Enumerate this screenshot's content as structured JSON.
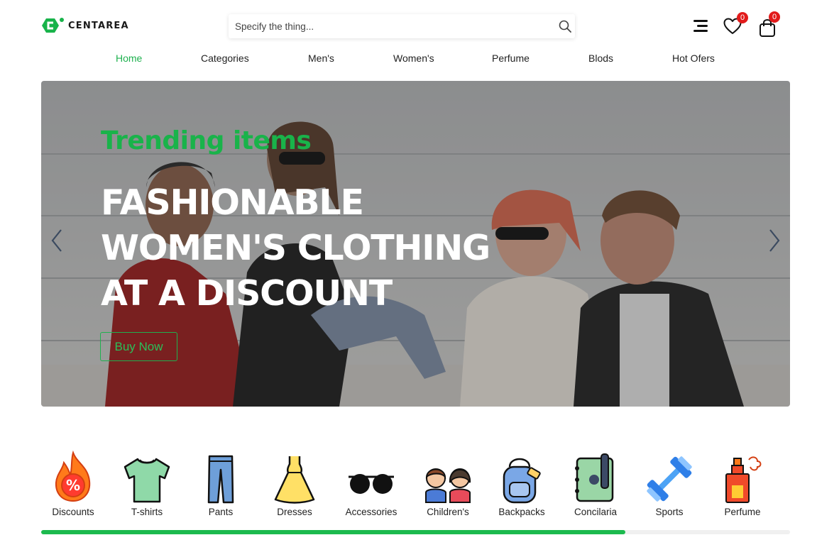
{
  "brand": {
    "name": "CENTAREA",
    "accent": "#1fb14f"
  },
  "search": {
    "placeholder": "Specify the thing..."
  },
  "header_icons": {
    "menu_icon": "menu-icon",
    "wishlist_count": "0",
    "cart_count": "0"
  },
  "nav": {
    "items": [
      {
        "label": "Home",
        "active": true
      },
      {
        "label": "Categories",
        "active": false
      },
      {
        "label": "Men's",
        "active": false
      },
      {
        "label": "Women's",
        "active": false
      },
      {
        "label": "Perfume",
        "active": false
      },
      {
        "label": "Blods",
        "active": false
      },
      {
        "label": "Hot Ofers",
        "active": false
      }
    ]
  },
  "hero": {
    "subtitle": "Trending items",
    "title_lines": [
      "FASHIONABLE",
      "WOMEN'S CLOTHING",
      "AT A DISCOUNT"
    ],
    "button_label": "Buy Now",
    "prev_icon": "chevron-left-icon",
    "next_icon": "chevron-right-icon"
  },
  "categories": {
    "items": [
      {
        "label": "Discounts",
        "icon": "discount-fire-icon"
      },
      {
        "label": "T-shirts",
        "icon": "tshirt-icon"
      },
      {
        "label": "Pants",
        "icon": "pants-icon"
      },
      {
        "label": "Dresses",
        "icon": "dress-icon"
      },
      {
        "label": "Accessories",
        "icon": "sunglasses-icon"
      },
      {
        "label": "Children's",
        "icon": "children-icon"
      },
      {
        "label": "Backpacks",
        "icon": "backpack-icon"
      },
      {
        "label": "Concilaria",
        "icon": "notebook-icon"
      },
      {
        "label": "Sports",
        "icon": "dumbbell-icon"
      },
      {
        "label": "Perfume",
        "icon": "perfume-icon"
      }
    ],
    "scroll_progress": 0.78
  }
}
